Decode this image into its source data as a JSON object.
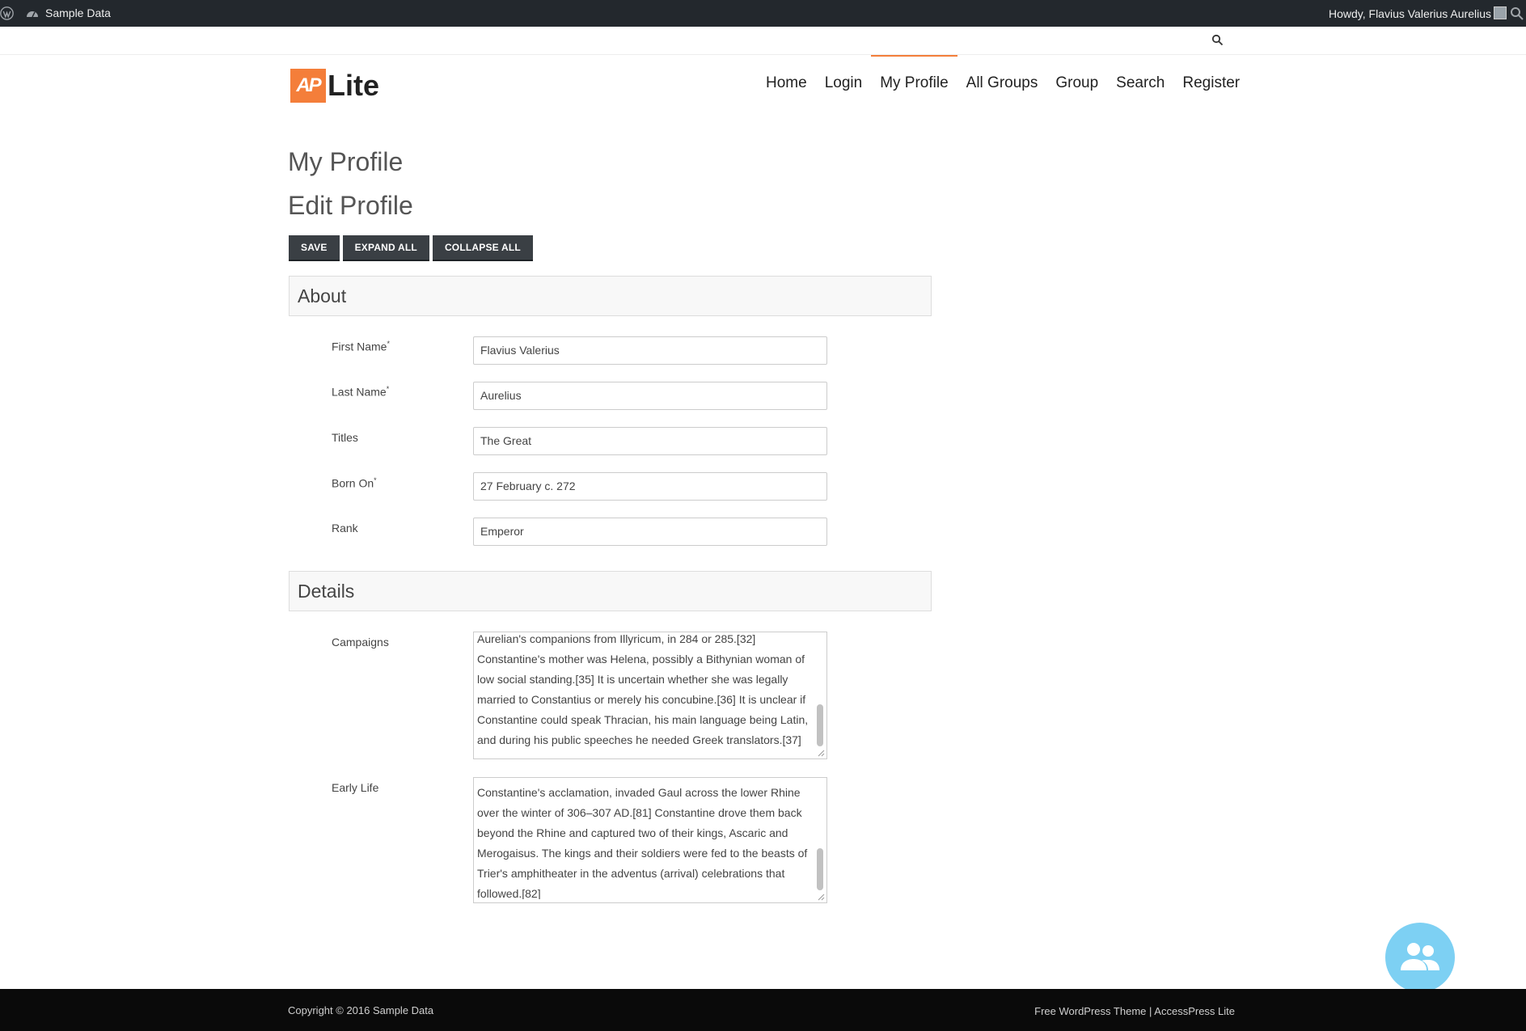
{
  "adminbar": {
    "site_name": "Sample Data",
    "howdy": "Howdy, Flavius Valerius Aurelius"
  },
  "header": {
    "logo_badge": "AP",
    "logo_text": "Lite",
    "nav": [
      {
        "label": "Home"
      },
      {
        "label": "Login"
      },
      {
        "label": "My Profile"
      },
      {
        "label": "All Groups"
      },
      {
        "label": "Group"
      },
      {
        "label": "Search"
      },
      {
        "label": "Register"
      }
    ],
    "active_nav": "My Profile",
    "accent_color": "#f47e3a"
  },
  "main": {
    "page_title": "My Profile",
    "form_title": "Edit Profile",
    "buttons": {
      "save": "SAVE",
      "expand": "EXPAND ALL",
      "collapse": "COLLAPSE ALL"
    },
    "about": {
      "heading": "About",
      "fields": [
        {
          "label": "First Name",
          "required": true,
          "value": "Flavius Valerius"
        },
        {
          "label": "Last Name",
          "required": true,
          "value": "Aurelius"
        },
        {
          "label": "Titles",
          "required": false,
          "value": "The Great"
        },
        {
          "label": "Born On",
          "required": true,
          "value": "27 February c. 272"
        },
        {
          "label": "Rank",
          "required": false,
          "value": "Emperor"
        }
      ]
    },
    "details": {
      "heading": "Details",
      "campaigns_label": "Campaigns",
      "campaigns_text": "Aurelian's companions from Illyricum, in 284 or 285.[32] Constantine's mother was Helena, possibly a Bithynian woman of low social standing.[35] It is uncertain whether she was legally married to Constantius or merely his concubine.[36] It is unclear if Constantine could speak Thracian, his main language being Latin, and during his public speeches he needed Greek translators.[37]",
      "early_life_label": "Early Life",
      "early_life_text": "Constantine's acclamation, invaded Gaul across the lower Rhine over the winter of 306–307 AD.[81] Constantine drove them back beyond the Rhine and captured two of their kings, Ascaric and Merogaisus. The kings and their soldiers were fed to the beasts of Trier's amphitheater in the adventus (arrival) celebrations that followed.[82]"
    }
  },
  "footer": {
    "copyright": "Copyright © 2016 Sample Data",
    "theme_link": "Free WordPress Theme",
    "separator": "|",
    "theme_name": "AccessPress Lite"
  },
  "icons": {
    "wordpress": "wordpress-icon",
    "site": "dashboard-icon",
    "search": "search-icon",
    "fab": "users-icon"
  }
}
